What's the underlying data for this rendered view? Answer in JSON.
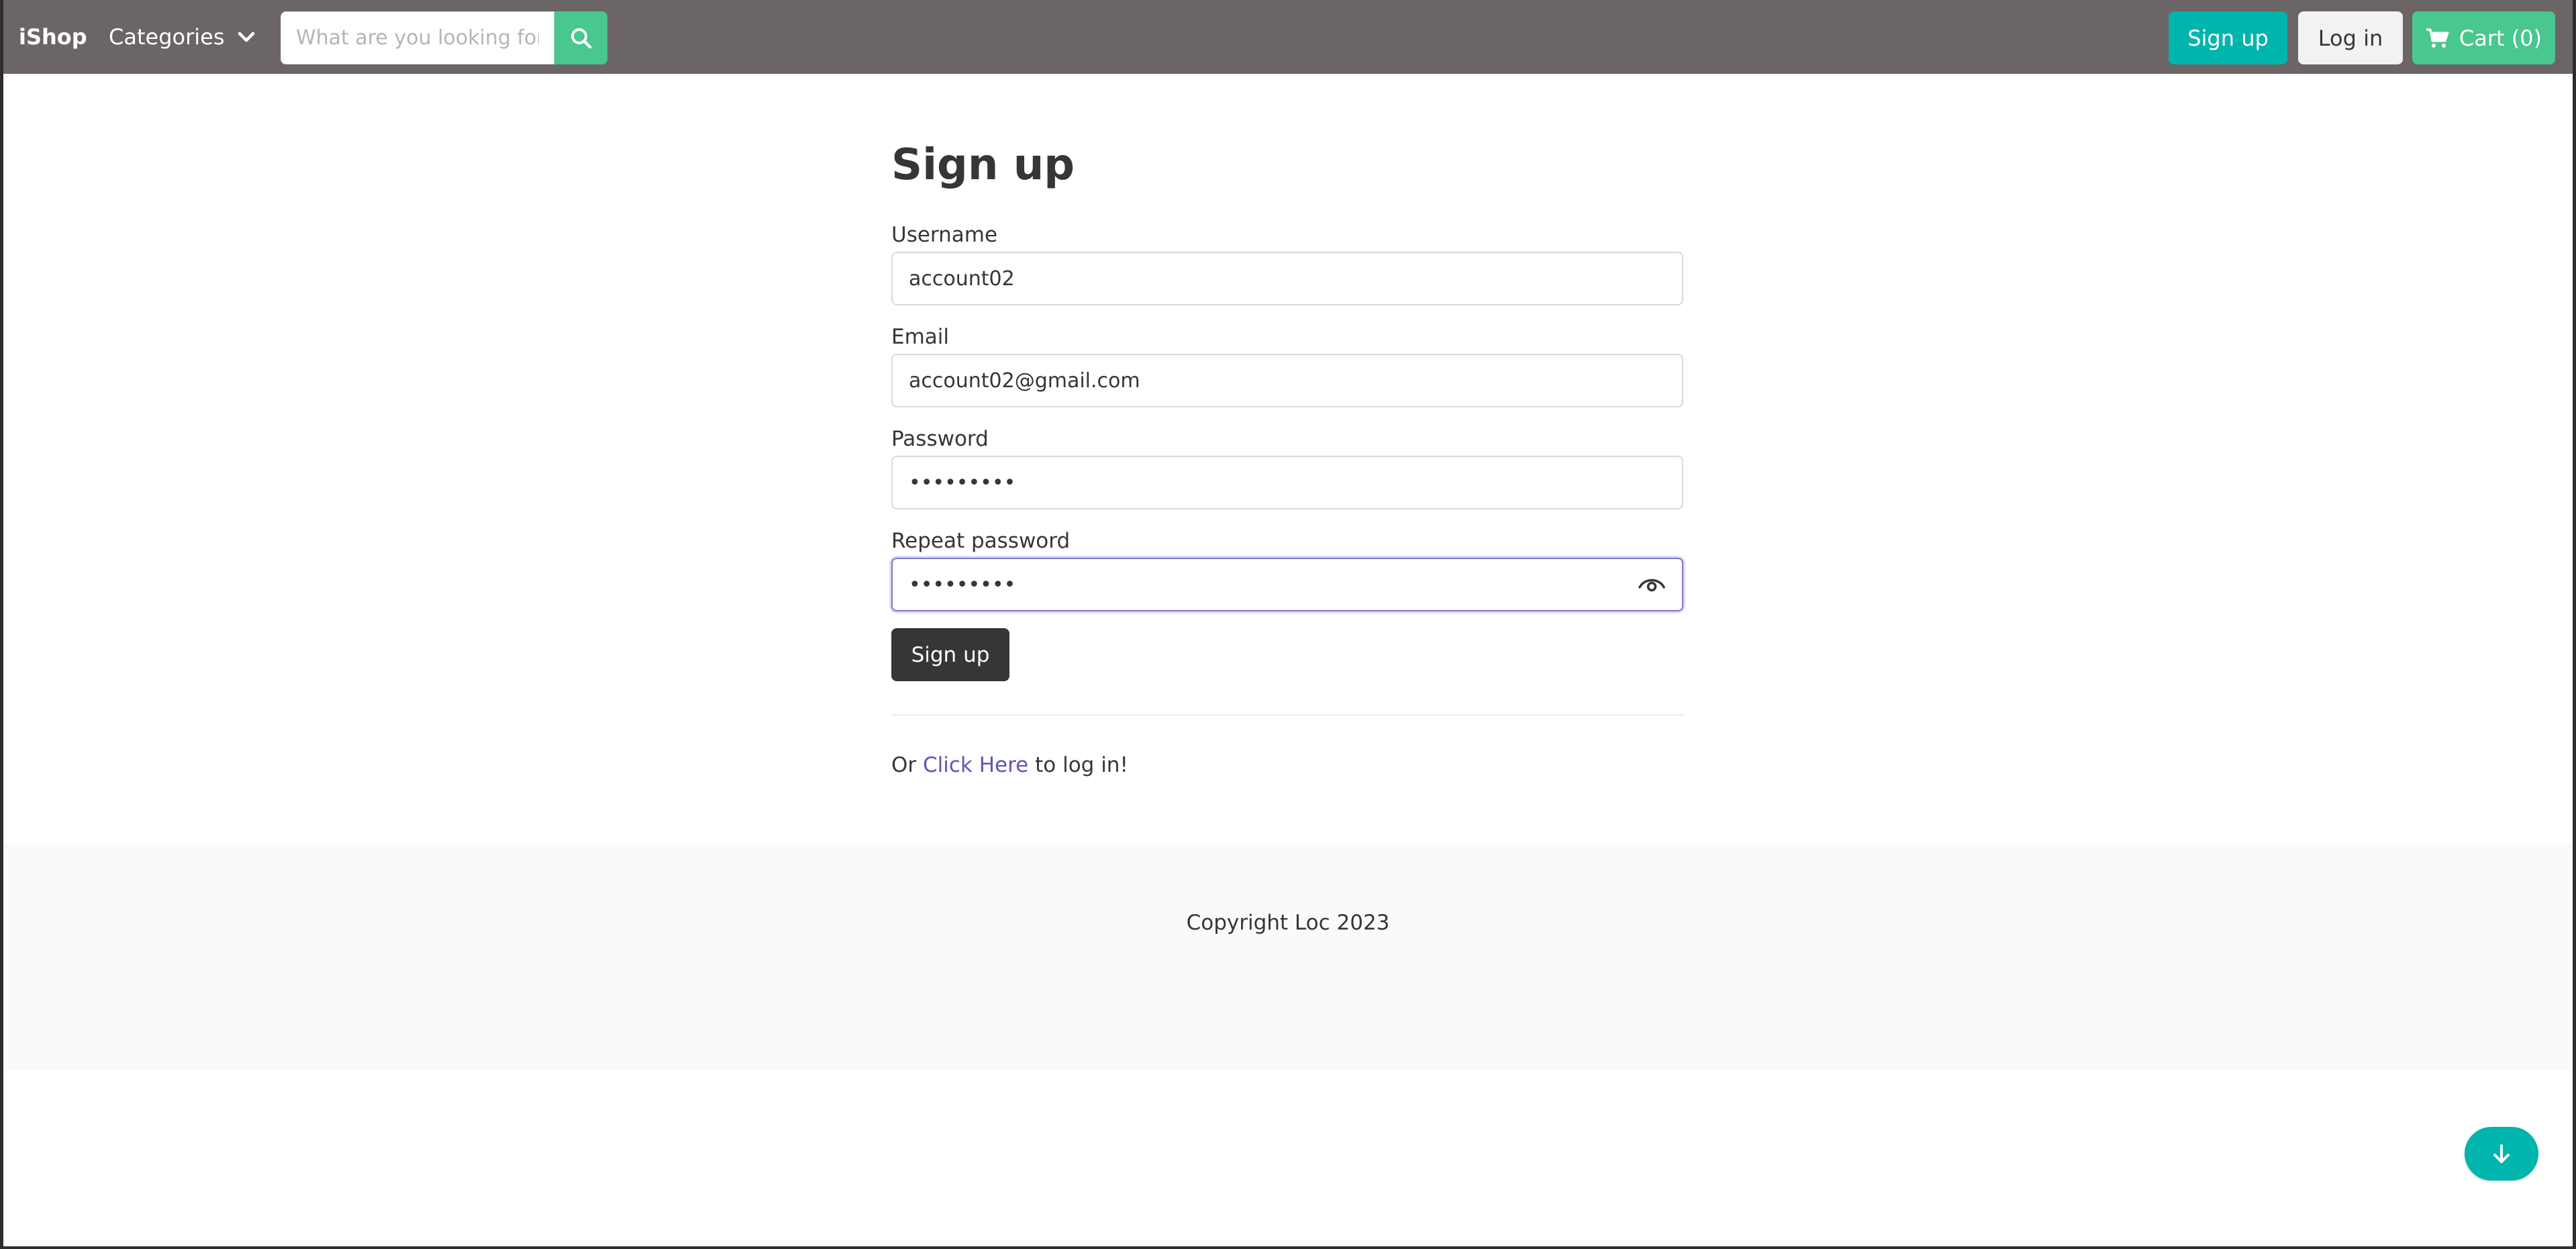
{
  "navbar": {
    "brand": "iShop",
    "categories_label": "Categories",
    "search_placeholder": "What are you looking for?",
    "signup_label": "Sign up",
    "login_label": "Log in",
    "cart_label": "Cart (0)"
  },
  "form": {
    "title": "Sign up",
    "username_label": "Username",
    "username_value": "account02",
    "email_label": "Email",
    "email_value": "account02@gmail.com",
    "password_label": "Password",
    "password_value": "•••••••••",
    "repeat_label": "Repeat password",
    "repeat_value": "•••••••••",
    "submit_label": "Sign up",
    "login_prefix": "Or ",
    "login_link": "Click Here",
    "login_suffix": " to log in!"
  },
  "footer": {
    "copyright": "Copyright Loc 2023"
  },
  "colors": {
    "navbar_bg": "#6b6565",
    "primary_teal": "#00b5ad",
    "success_green": "#48c78e",
    "dark_button": "#363636",
    "link": "#5a57b5",
    "focus_border": "#7a78c8"
  },
  "icons": {
    "search": "search-icon",
    "chevron": "chevron-down-icon",
    "cart": "cart-icon",
    "eye": "eye-icon",
    "scroll": "arrow-down-icon"
  }
}
